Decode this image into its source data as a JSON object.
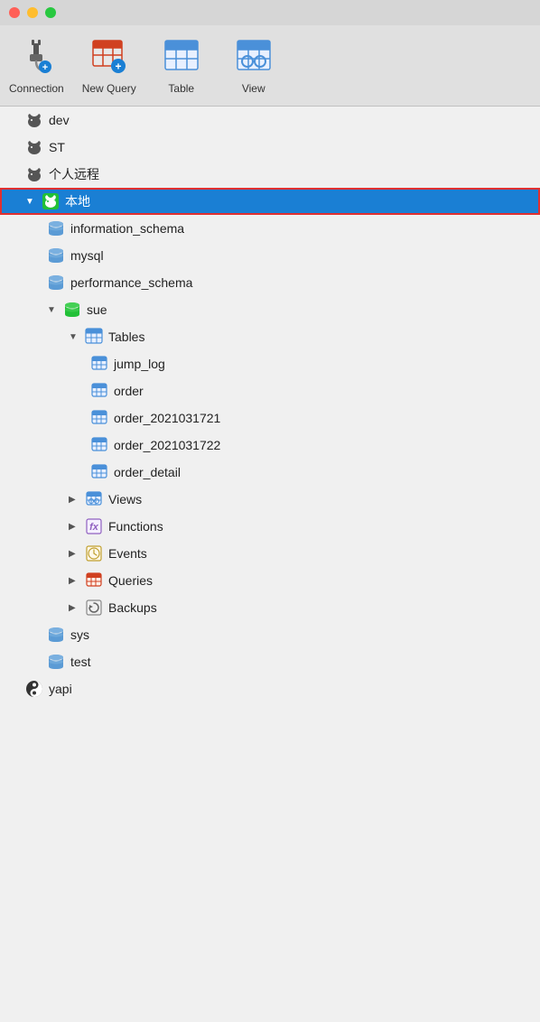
{
  "titleBar": {
    "trafficLights": [
      "red",
      "yellow",
      "green"
    ]
  },
  "toolbar": {
    "items": [
      {
        "id": "connection",
        "label": "Connection"
      },
      {
        "id": "new-query",
        "label": "New Query"
      },
      {
        "id": "table",
        "label": "Table"
      },
      {
        "id": "view",
        "label": "View"
      }
    ]
  },
  "tree": {
    "items": [
      {
        "id": "dev",
        "label": "dev",
        "level": 1,
        "icon": "dolphin",
        "chevron": false,
        "selected": false
      },
      {
        "id": "st",
        "label": "ST",
        "level": 1,
        "icon": "dolphin",
        "chevron": false,
        "selected": false
      },
      {
        "id": "personal-remote",
        "label": "个人远程",
        "level": 1,
        "icon": "dolphin",
        "chevron": false,
        "selected": false
      },
      {
        "id": "local",
        "label": "本地",
        "level": 1,
        "icon": "dolphin-green",
        "chevron": true,
        "chevron-open": true,
        "selected": true
      },
      {
        "id": "information_schema",
        "label": "information_schema",
        "level": 2,
        "icon": "database",
        "selected": false
      },
      {
        "id": "mysql",
        "label": "mysql",
        "level": 2,
        "icon": "database",
        "selected": false
      },
      {
        "id": "performance_schema",
        "label": "performance_schema",
        "level": 2,
        "icon": "database",
        "selected": false
      },
      {
        "id": "sue",
        "label": "sue",
        "level": 2,
        "icon": "database-green",
        "chevron": true,
        "chevron-open": true,
        "selected": false
      },
      {
        "id": "tables-group",
        "label": "Tables",
        "level": 3,
        "icon": "table-blue",
        "chevron": true,
        "chevron-open": true,
        "selected": false
      },
      {
        "id": "jump_log",
        "label": "jump_log",
        "level": 4,
        "icon": "table-blue-small",
        "selected": false
      },
      {
        "id": "order",
        "label": "order",
        "level": 4,
        "icon": "table-blue-small",
        "selected": false
      },
      {
        "id": "order_2021031721",
        "label": "order_2021031721",
        "level": 4,
        "icon": "table-blue-small",
        "selected": false
      },
      {
        "id": "order_2021031722",
        "label": "order_2021031722",
        "level": 4,
        "icon": "table-blue-small",
        "selected": false
      },
      {
        "id": "order_detail",
        "label": "order_detail",
        "level": 4,
        "icon": "table-blue-small",
        "selected": false
      },
      {
        "id": "views-group",
        "label": "Views",
        "level": 3,
        "icon": "views-icon",
        "chevron": true,
        "chevron-open": false,
        "selected": false
      },
      {
        "id": "functions-group",
        "label": "Functions",
        "level": 3,
        "icon": "functions-icon",
        "chevron": true,
        "chevron-open": false,
        "selected": false
      },
      {
        "id": "events-group",
        "label": "Events",
        "level": 3,
        "icon": "events-icon",
        "chevron": true,
        "chevron-open": false,
        "selected": false
      },
      {
        "id": "queries-group",
        "label": "Queries",
        "level": 3,
        "icon": "queries-icon",
        "chevron": true,
        "chevron-open": false,
        "selected": false
      },
      {
        "id": "backups-group",
        "label": "Backups",
        "level": 3,
        "icon": "backups-icon",
        "chevron": true,
        "chevron-open": false,
        "selected": false
      },
      {
        "id": "sys",
        "label": "sys",
        "level": 2,
        "icon": "database",
        "selected": false
      },
      {
        "id": "test",
        "label": "test",
        "level": 2,
        "icon": "database",
        "selected": false
      },
      {
        "id": "yapi",
        "label": "yapi",
        "level": 1,
        "icon": "yapi-icon",
        "selected": false
      }
    ]
  }
}
